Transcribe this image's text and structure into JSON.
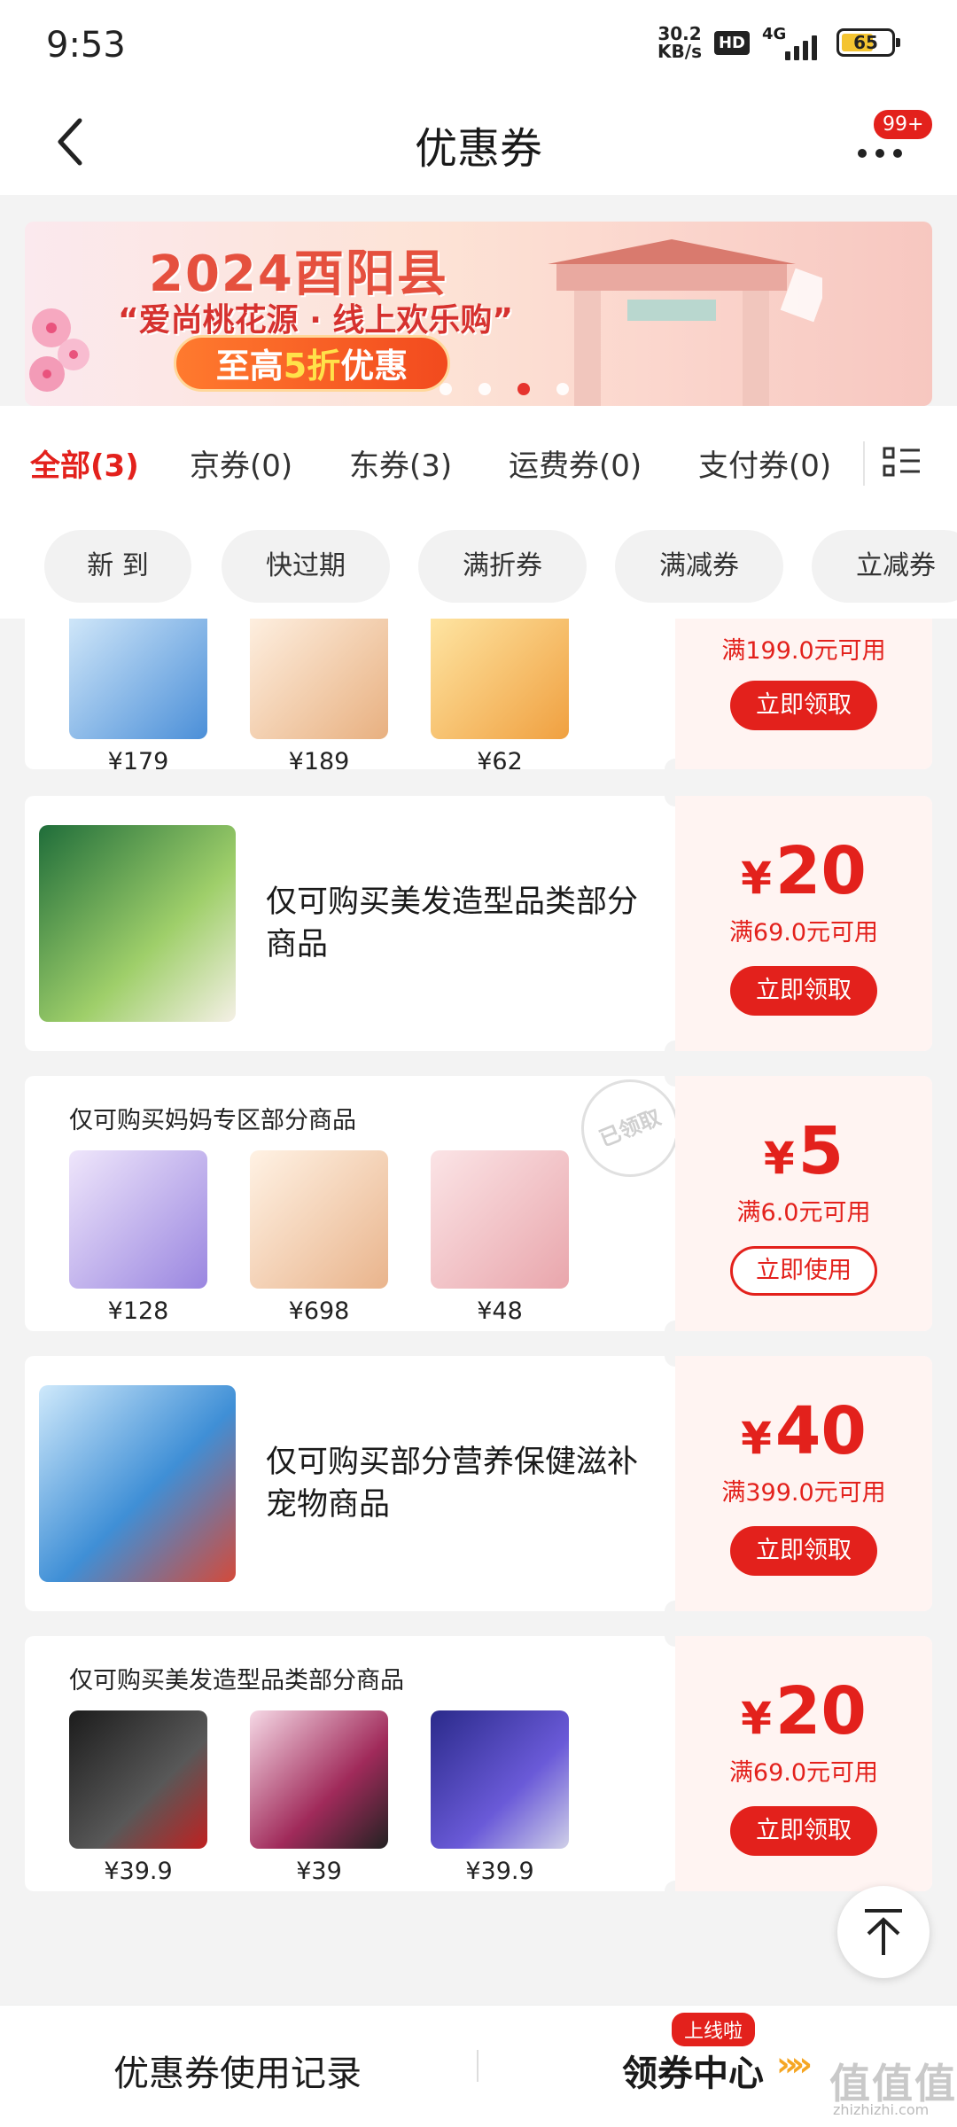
{
  "status": {
    "time": "9:53",
    "net_speed_value": "30.2",
    "net_speed_unit": "KB/s",
    "hd": "HD",
    "network": "4G",
    "battery": "65",
    "battery_level": 0.65
  },
  "header": {
    "title": "优惠券",
    "badge": "99+"
  },
  "banner": {
    "title": "2024酉阳县",
    "subtitle": "“爱尚桃花源 · 线上欢乐购”",
    "cta_pre": "至高",
    "cta_highlight": "5折",
    "cta_post": "优惠",
    "slide_count": 4,
    "active_slide": 3
  },
  "tabs": [
    {
      "label": "全部(3)",
      "active": true
    },
    {
      "label": "京券(0)",
      "active": false
    },
    {
      "label": "东券(3)",
      "active": false
    },
    {
      "label": "运费券(0)",
      "active": false
    },
    {
      "label": "支付券(0)",
      "active": false
    }
  ],
  "chips": [
    "新 到",
    "快过期",
    "满折券",
    "满减券",
    "立减券"
  ],
  "coupons": [
    {
      "condition": "满199.0元可用",
      "button": "立即领取",
      "products": [
        {
          "price": "¥179"
        },
        {
          "price": "¥189"
        },
        {
          "price": "¥62"
        }
      ]
    },
    {
      "currency": "¥",
      "amount": "20",
      "condition": "满69.0元可用",
      "button": "立即领取",
      "scope": "仅可购买美发造型品类部分商品"
    },
    {
      "currency": "¥",
      "amount": "5",
      "condition": "满6.0元可用",
      "button": "立即使用",
      "scope": "仅可购买妈妈专区部分商品",
      "stamp": "已领取",
      "products": [
        {
          "price": "¥128"
        },
        {
          "price": "¥698"
        },
        {
          "price": "¥48"
        }
      ]
    },
    {
      "currency": "¥",
      "amount": "40",
      "condition": "满399.0元可用",
      "button": "立即领取",
      "scope": "仅可购买部分营养保健滋补宠物商品"
    },
    {
      "currency": "¥",
      "amount": "20",
      "condition": "满69.0元可用",
      "button": "立即领取",
      "scope": "仅可购买美发造型品类部分商品",
      "products": [
        {
          "price": "¥39.9"
        },
        {
          "price": "¥39"
        },
        {
          "price": "¥39.9"
        }
      ]
    }
  ],
  "bottom": {
    "history": "优惠券使用记录",
    "center": "领券中心",
    "arrows": "»»",
    "new_badge": "上线啦"
  },
  "watermark": {
    "text": "值值值",
    "sub": "zhizhizhi.com"
  },
  "colors": {
    "accent": "#e3211c",
    "coupon_bg": "#fff4f2",
    "page_bg": "#f3f3f3"
  }
}
